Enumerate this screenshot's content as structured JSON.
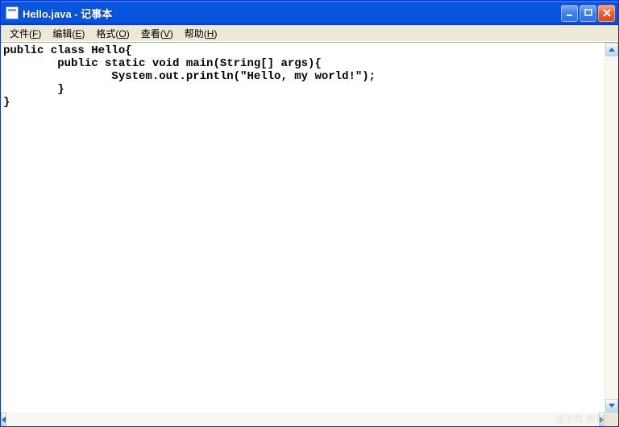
{
  "window": {
    "title": "Hello.java - 记事本"
  },
  "menu": {
    "items": [
      {
        "label": "文件",
        "hotkey": "F"
      },
      {
        "label": "编辑",
        "hotkey": "E"
      },
      {
        "label": "格式",
        "hotkey": "O"
      },
      {
        "label": "查看",
        "hotkey": "V"
      },
      {
        "label": "帮助",
        "hotkey": "H"
      }
    ]
  },
  "editor": {
    "content": "public class Hello{\n        public static void main(String[] args){\n                System.out.println(\"Hello, my world!\");\n        }\n}"
  },
  "watermark": "查字典 教程网"
}
